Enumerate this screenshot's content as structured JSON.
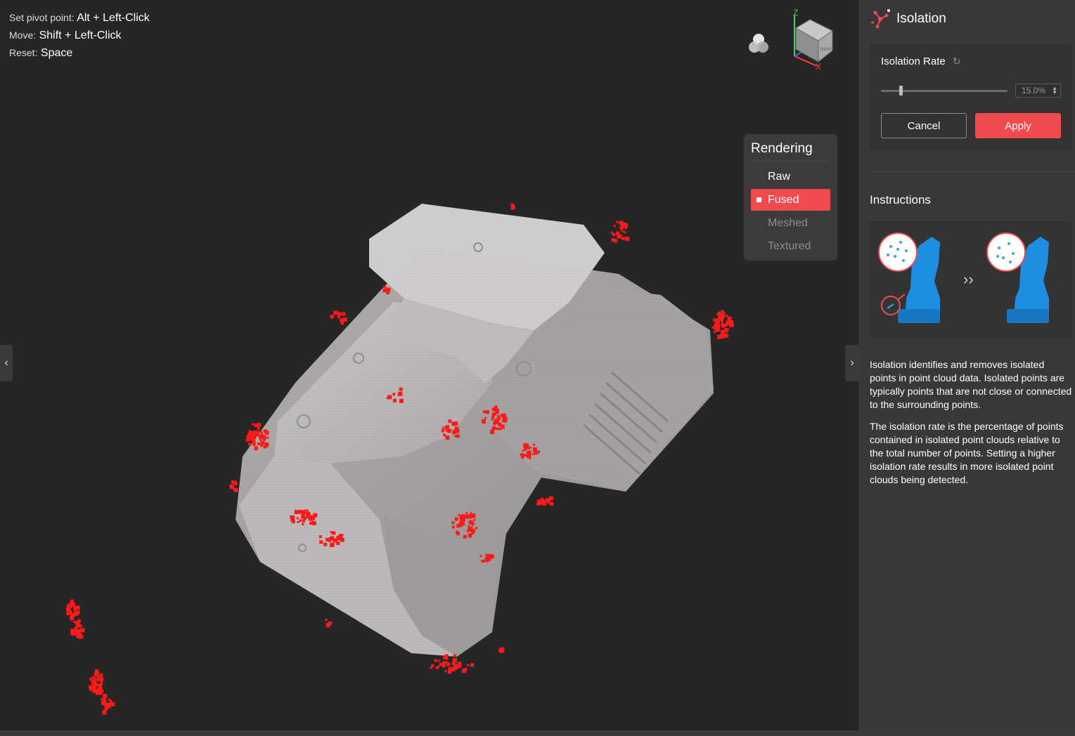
{
  "hints": [
    {
      "key": "Set pivot point:",
      "value": "Alt + Left-Click"
    },
    {
      "key": "Move:",
      "value": "Shift + Left-Click"
    },
    {
      "key": "Reset:",
      "value": "Space"
    }
  ],
  "view_cube": {
    "axis_z": "Z",
    "axis_x": "X",
    "face_right": "RIGHT"
  },
  "rendering": {
    "title": "Rendering",
    "items": [
      {
        "label": "Raw",
        "state": "normal"
      },
      {
        "label": "Fused",
        "state": "active"
      },
      {
        "label": "Meshed",
        "state": "disabled"
      },
      {
        "label": "Textured",
        "state": "disabled"
      }
    ]
  },
  "panel": {
    "title": "Isolation",
    "icon": "isolation-icon",
    "rate": {
      "label": "Isolation Rate",
      "value_text": "15.0%",
      "value_fraction": 0.15
    },
    "cancel_label": "Cancel",
    "apply_label": "Apply",
    "instructions_title": "Instructions",
    "instructions": [
      "Isolation identifies and removes isolated points in point cloud data. Isolated points are typically points that are not close or connected to the surrounding points.",
      "The isolation rate is the percentage of points contained in isolated point clouds relative to the total number of points. Setting a higher isolation rate results in more isolated point clouds being detected."
    ],
    "arrow_glyph": "››"
  },
  "colors": {
    "accent": "#f04a4f",
    "model": "#b8b8b8",
    "points": "#ff1a1a",
    "bust": "#1e8fe0"
  }
}
